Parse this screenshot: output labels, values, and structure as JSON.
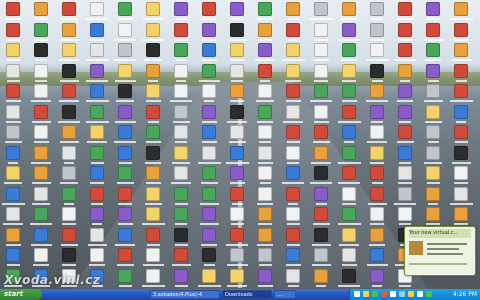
{
  "desktop": {
    "wallpaper": "airport-runway",
    "icon_rows": 14,
    "icon_cols": 17,
    "icon_palette": [
      "#f2f2f2",
      "#e9a13b",
      "#f4d36b",
      "#3b7bd8",
      "#d24b3a",
      "#4aa65a",
      "#8a5cc9",
      "#2c2c2c",
      "#e5e5e5",
      "#c0c6cc"
    ]
  },
  "taskbar": {
    "start_label": "start",
    "tasks": [
      {
        "label": "3.askaden/4.Plus/-4"
      },
      {
        "label": "Downloads"
      },
      {
        "label": "...."
      }
    ],
    "clock": "4:26 PM"
  },
  "notification": {
    "title": "Your new virtual.c..."
  },
  "watermark": "Xvoda.vinl.cz"
}
